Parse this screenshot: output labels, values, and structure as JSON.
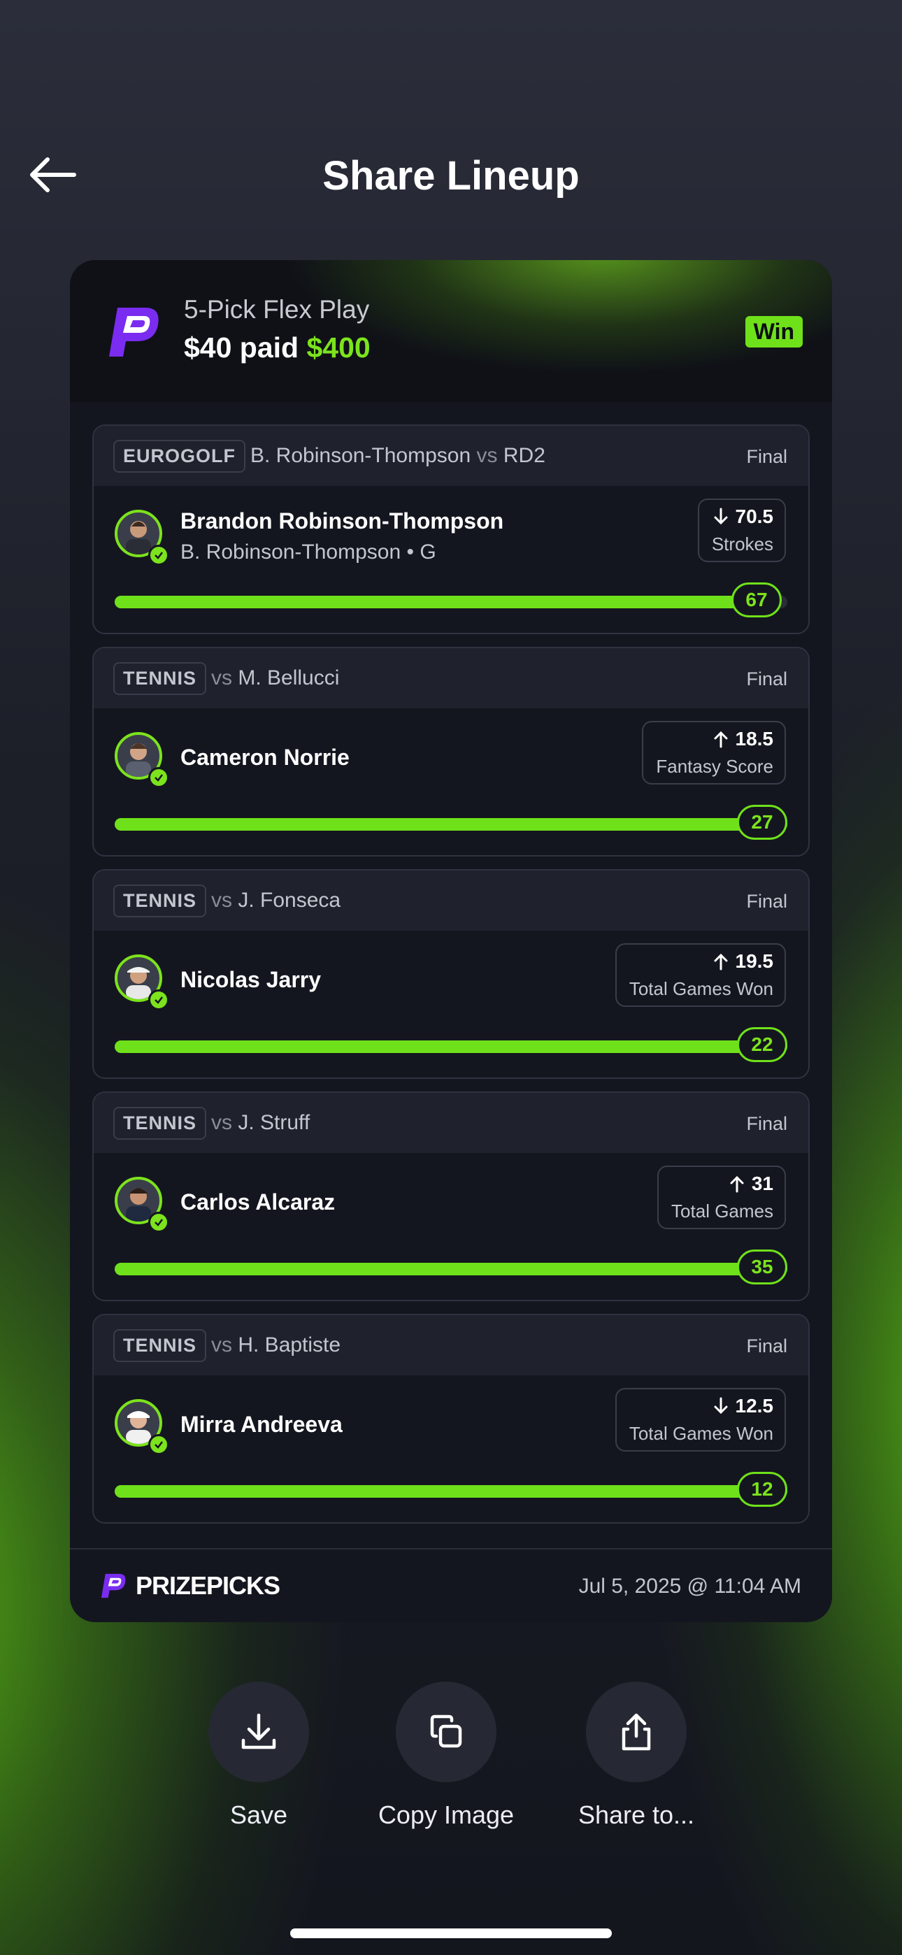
{
  "header": {
    "title": "Share Lineup",
    "back_icon": "arrow-left-icon"
  },
  "card": {
    "play_type": "5-Pick Flex Play",
    "paid": "$40 paid",
    "payout": "$400",
    "badge": "Win",
    "footer_brand": "PRIZEPICKS",
    "timestamp": "Jul 5, 2025 @ 11:04 AM"
  },
  "picks": [
    {
      "league": "EUROGOLF",
      "player_a": "B. Robinson-Thompson",
      "vs": "vs",
      "opponent": "RD2",
      "status": "Final",
      "name": "Brandon Robinson-Thompson",
      "subtitle": "B. Robinson-Thompson • G",
      "direction": "down",
      "line": "70.5",
      "stat": "Strokes",
      "result": "67",
      "progress": 0.95
    },
    {
      "league": "TENNIS",
      "vs": "vs",
      "opponent": "M. Bellucci",
      "status": "Final",
      "name": "Cameron Norrie",
      "direction": "up",
      "line": "18.5",
      "stat": "Fantasy Score",
      "result": "27",
      "progress": 1.0
    },
    {
      "league": "TENNIS",
      "vs": "vs",
      "opponent": "J. Fonseca",
      "status": "Final",
      "name": "Nicolas Jarry",
      "direction": "up",
      "line": "19.5",
      "stat": "Total Games Won",
      "result": "22",
      "progress": 1.0
    },
    {
      "league": "TENNIS",
      "vs": "vs",
      "opponent": "J. Struff",
      "status": "Final",
      "name": "Carlos Alcaraz",
      "direction": "up",
      "line": "31",
      "stat": "Total Games",
      "result": "35",
      "progress": 1.0
    },
    {
      "league": "TENNIS",
      "vs": "vs",
      "opponent": "H. Baptiste",
      "status": "Final",
      "name": "Mirra Andreeva",
      "direction": "down",
      "line": "12.5",
      "stat": "Total Games Won",
      "result": "12",
      "progress": 1.0
    }
  ],
  "actions": [
    {
      "label": "Save",
      "icon": "download-icon"
    },
    {
      "label": "Copy Image",
      "icon": "copy-icon"
    },
    {
      "label": "Share to...",
      "icon": "share-icon"
    }
  ],
  "colors": {
    "accent": "#7ce31d",
    "card_bg": "#14161f",
    "brand_purple": "#7a2cf0"
  }
}
